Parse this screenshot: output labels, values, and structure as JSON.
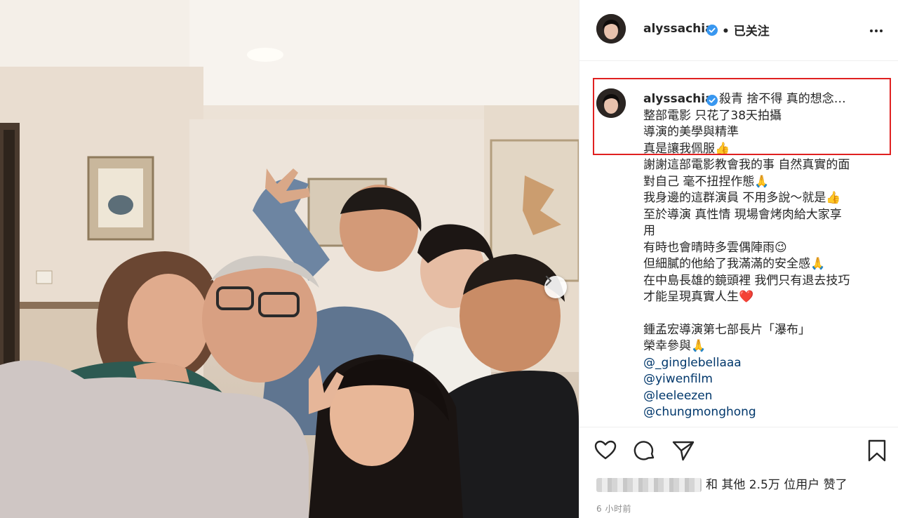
{
  "post": {
    "username": "alyssachia",
    "follow_state": "• 已关注",
    "caption_lines": [
      "殺青 捨不得 真的想念…",
      "整部電影 只花了38天拍攝",
      "導演的美學與精準",
      "真是讓我佩服👍",
      "謝謝這部電影教會我的事 自然真實的面",
      "對自己 毫不扭捏作態🙏",
      "我身邊的這群演員 不用多說～就是👍",
      "至於導演 真性情 現場會烤肉給大家享",
      "用",
      "有時也會晴時多雲偶陣雨😉",
      "但細膩的他給了我滿滿的安全感🙏",
      "在中島長雄的鏡頭裡 我們只有退去技巧",
      "才能呈現真實人生❤️",
      "鍾孟宏導演第七部長片「瀑布」",
      "榮幸參與🙏"
    ],
    "mentions": [
      "@_ginglebellaaa",
      "@yiwenfilm",
      "@leeleezen",
      "@chungmonghong"
    ],
    "likes_text": "和 其他 2.5万 位用户 赞了",
    "time_ago": "6 小时前"
  },
  "icons": {
    "verified": "verified-badge-icon",
    "like": "heart-icon",
    "comment": "comment-icon",
    "share": "paper-plane-icon",
    "save": "bookmark-icon",
    "next": "chevron-right-icon",
    "more": "more-options-icon"
  },
  "colors": {
    "text": "#262626",
    "verified": "#3897f0",
    "mention": "#00376b",
    "highlight_box": "#e02020"
  }
}
